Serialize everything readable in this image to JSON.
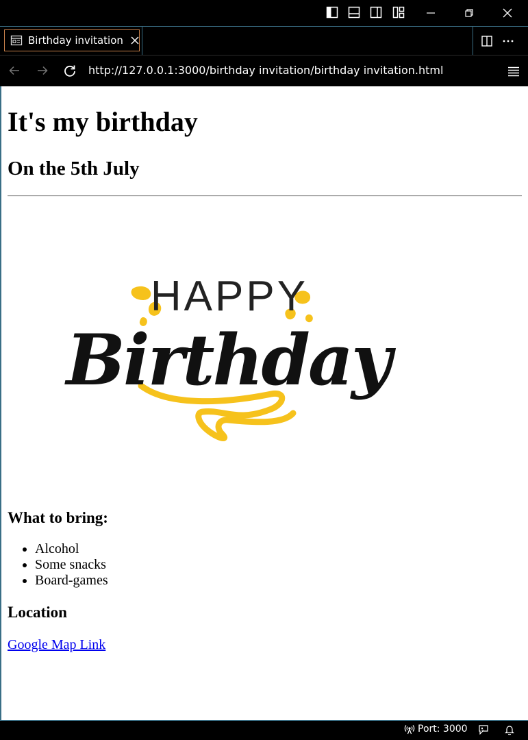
{
  "tab": {
    "title": "Birthday invitation"
  },
  "address_bar": {
    "url": "http://127.0.0.1:3000/birthday invitation/birthday invitation.html"
  },
  "page": {
    "heading": "It's my birthday",
    "subheading": "On the 5th July",
    "image": {
      "line1": "HAPPY",
      "line2": "Birthday"
    },
    "bring_heading": "What to bring:",
    "bring_items": [
      "Alcohol",
      "Some snacks",
      "Board-games"
    ],
    "location_heading": "Location",
    "map_link": "Google Map Link"
  },
  "status_bar": {
    "port": "Port: 3000"
  },
  "icons": {
    "titlebar": [
      "layout-sidebar-left-icon",
      "layout-panel-icon",
      "layout-sidebar-right-icon",
      "customize-layout-icon"
    ],
    "window": [
      "minimize-icon",
      "restore-icon",
      "close-icon"
    ],
    "tab": [
      "preview-icon",
      "tab-close-icon"
    ],
    "tabstrip": [
      "split-editor-icon",
      "more-actions-icon"
    ],
    "nav": [
      "back-icon",
      "forward-icon",
      "reload-icon",
      "menu-icon"
    ],
    "status": [
      "broadcast-icon",
      "feedback-icon",
      "bell-icon"
    ]
  },
  "colors": {
    "accent_border": "#3a6f86",
    "tab_border": "#c8814b",
    "link": "#0000ee",
    "cake_yellow": "#f6c21c"
  }
}
